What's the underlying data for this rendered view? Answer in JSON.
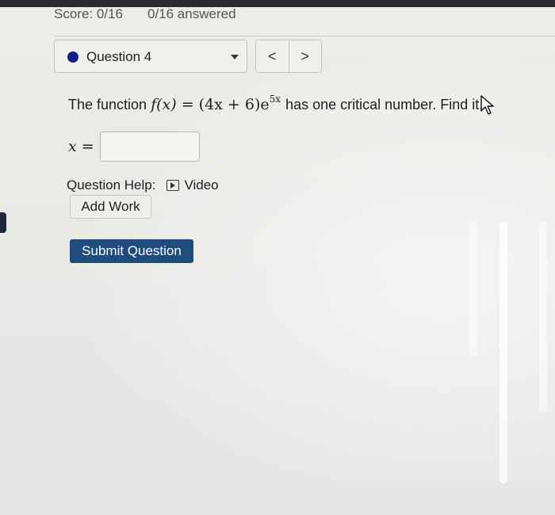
{
  "header": {
    "score": "Score: 0/16",
    "answered": "0/16 answered"
  },
  "question_selector": {
    "label": "Question 4",
    "dot_color": "#0f1f8a"
  },
  "nav": {
    "prev": "<",
    "next": ">"
  },
  "question": {
    "prefix": "The function",
    "fx": "f(x)",
    "equals": "=",
    "base": "(4x + 6)e",
    "exponent": "5x",
    "suffix": "has one critical number. Find it."
  },
  "answer": {
    "label": "x =",
    "value": "",
    "placeholder": ""
  },
  "help": {
    "label": "Question Help:",
    "video_label": "Video",
    "video_icon": "play-icon"
  },
  "buttons": {
    "add_work": "Add Work",
    "submit": "Submit Question"
  },
  "colors": {
    "submit_bg": "#1d4c7d",
    "accent_dot": "#0f1f8a"
  }
}
